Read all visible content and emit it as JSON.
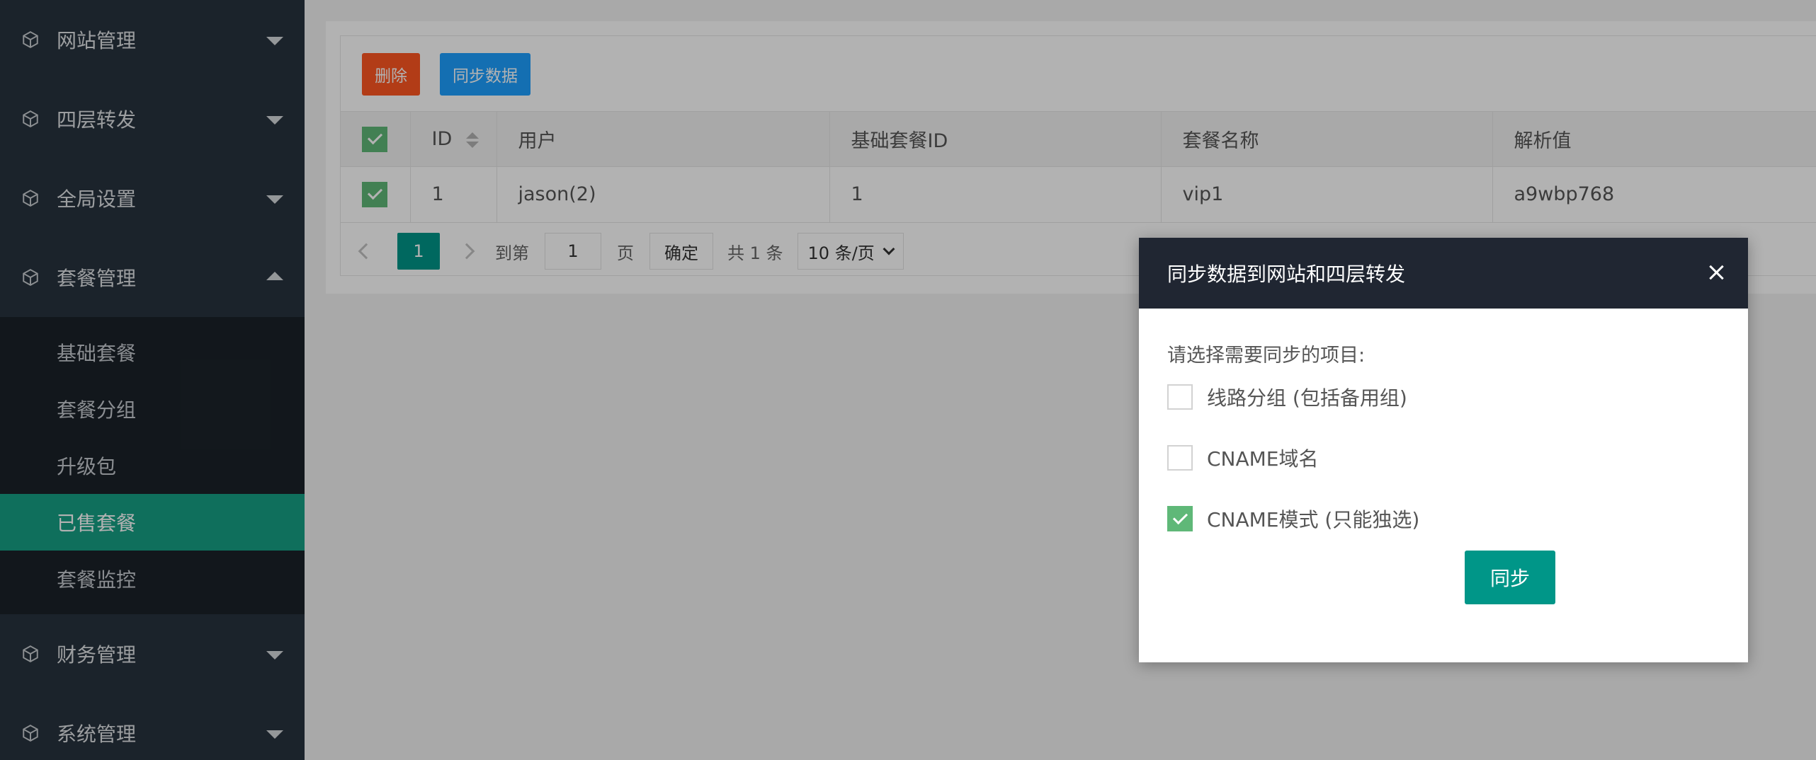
{
  "sidebar": {
    "items": [
      {
        "label": "网站管理"
      },
      {
        "label": "四层转发"
      },
      {
        "label": "全局设置"
      },
      {
        "label": "套餐管理"
      }
    ],
    "submenu": [
      {
        "label": "基础套餐"
      },
      {
        "label": "套餐分组"
      },
      {
        "label": "升级包"
      },
      {
        "label": "已售套餐"
      },
      {
        "label": "套餐监控"
      }
    ],
    "items_after": [
      {
        "label": "财务管理"
      },
      {
        "label": "系统管理"
      }
    ]
  },
  "toolbar": {
    "delete_label": "删除",
    "sync_label": "同步数据"
  },
  "table": {
    "headers": {
      "id": "ID",
      "user": "用户",
      "base_plan_id": "基础套餐ID",
      "plan_name": "套餐名称",
      "resolve": "解析值"
    },
    "rows": [
      {
        "id": "1",
        "user": "jason(2)",
        "base_plan_id": "1",
        "plan_name": "vip1",
        "resolve": "a9wbp768"
      }
    ]
  },
  "pager": {
    "current": "1",
    "goto_label": "到第",
    "goto_value": "1",
    "page_label": "页",
    "confirm_label": "确定",
    "total_label": "共 1 条",
    "page_size": "10 条/页"
  },
  "modal": {
    "title": "同步数据到网站和四层转发",
    "prompt": "请选择需要同步的项目:",
    "options": [
      {
        "label": "线路分组 (包括备用组)"
      },
      {
        "label": "CNAME域名"
      },
      {
        "label": "CNAME模式 (只能独选)"
      }
    ],
    "button_label": "同步"
  },
  "colors": {
    "sidebar_bg": "#28333e",
    "active_bg": "#16a085",
    "danger": "#ff5722",
    "primary": "#1e9fff",
    "teal": "#009688",
    "check_green": "#5fb878"
  }
}
